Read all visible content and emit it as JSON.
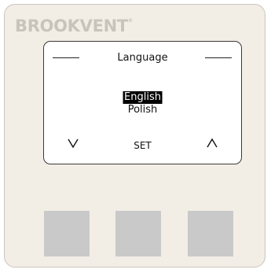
{
  "device": {
    "brand": "BROOKVENT",
    "brand_mark": "®"
  },
  "screen": {
    "title": "Language",
    "options": [
      {
        "label": "English",
        "selected": true
      },
      {
        "label": "Polish",
        "selected": false
      }
    ],
    "nav": {
      "down_icon": "chevron-down-icon",
      "set_label": "SET",
      "up_icon": "chevron-up-icon"
    }
  },
  "buttons": [
    {
      "name": "left-physical-button"
    },
    {
      "name": "center-physical-button"
    },
    {
      "name": "right-physical-button"
    }
  ],
  "colors": {
    "housing": "#f2eee6",
    "brand": "#c8c4bc",
    "screen_bg": "#ffffff",
    "highlight": "#000000",
    "button": "#c9c9c9"
  }
}
